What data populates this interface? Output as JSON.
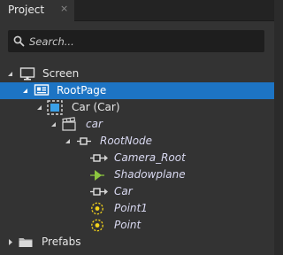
{
  "tab": {
    "title": "Project",
    "close_glyph": "×"
  },
  "search": {
    "placeholder": "Search..."
  },
  "tree": [
    {
      "label": "Screen",
      "icon": "monitor-icon",
      "expanded": true,
      "italic": false,
      "selected": false
    },
    {
      "label": "RootPage",
      "icon": "page-icon",
      "expanded": true,
      "italic": false,
      "selected": true
    },
    {
      "label": "Car (Car)",
      "icon": "prefab-instance-icon",
      "expanded": true,
      "italic": false,
      "selected": false
    },
    {
      "label": "car",
      "icon": "clapperboard-icon",
      "expanded": true,
      "italic": true,
      "selected": false
    },
    {
      "label": "RootNode",
      "icon": "node-icon",
      "expanded": true,
      "italic": true,
      "selected": false
    },
    {
      "label": "Camera_Root",
      "icon": "node-icon",
      "expanded": false,
      "italic": true,
      "selected": false
    },
    {
      "label": "Shadowplane",
      "icon": "mesh-icon",
      "expanded": null,
      "italic": true,
      "selected": false
    },
    {
      "label": "Car",
      "icon": "node-icon",
      "expanded": false,
      "italic": true,
      "selected": false
    },
    {
      "label": "Point1",
      "icon": "light-icon",
      "expanded": null,
      "italic": true,
      "selected": false
    },
    {
      "label": "Point",
      "icon": "light-icon",
      "expanded": null,
      "italic": true,
      "selected": false
    },
    {
      "label": "Prefabs",
      "icon": "folder-icon",
      "expanded": false,
      "italic": false,
      "selected": false
    }
  ],
  "colors": {
    "panel": "#333333",
    "tabbar": "#232323",
    "search_bg": "#1e1e1e",
    "selection": "#1d74c4",
    "light_icon": "#f2d21b",
    "mesh_icon": "#8cc63f"
  }
}
